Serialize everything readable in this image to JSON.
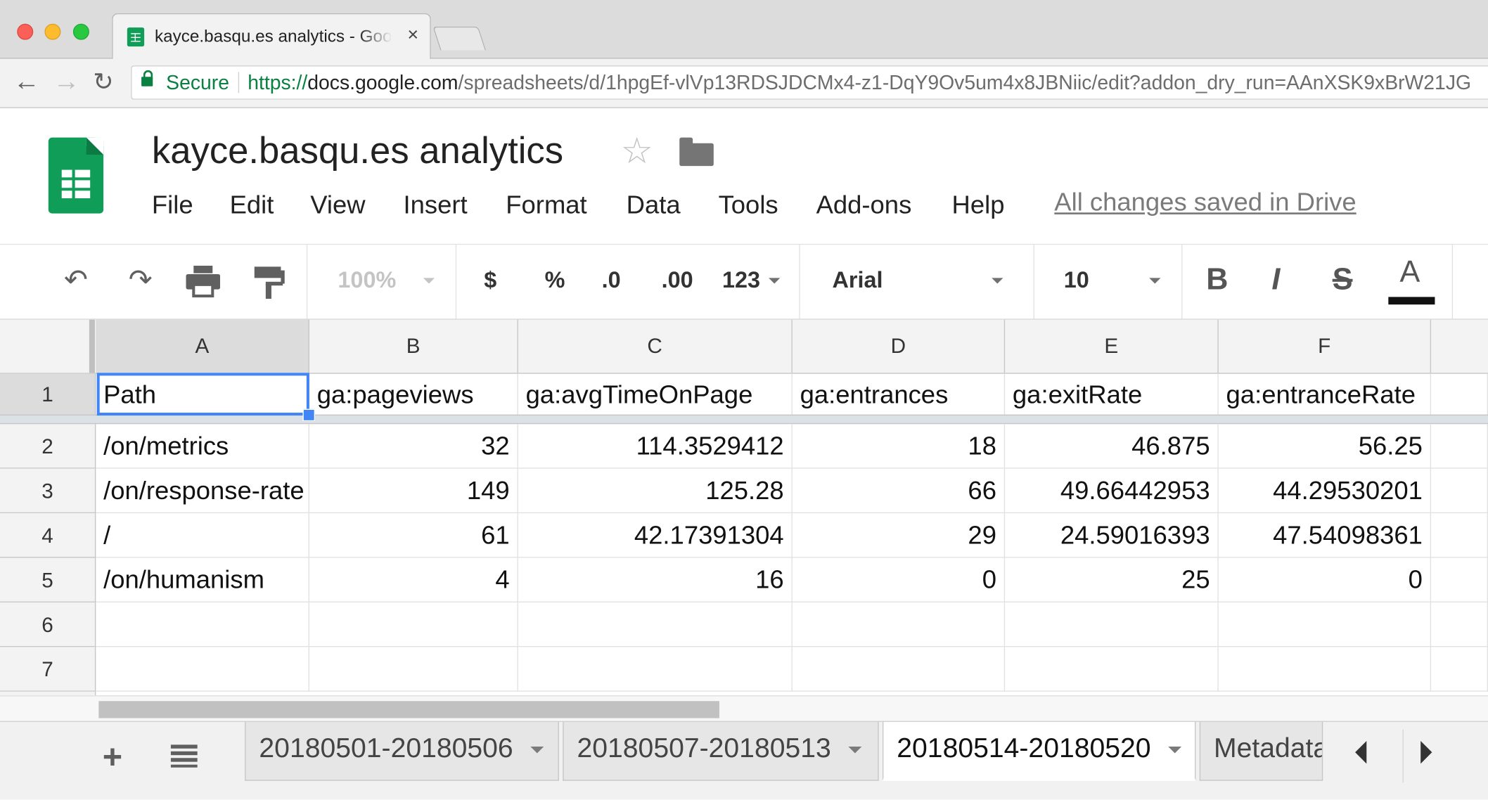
{
  "browser": {
    "tab_title": "kayce.basqu.es analytics - Google Sheets",
    "tab_close": "×",
    "secure_label": "Secure",
    "url_scheme": "https://",
    "url_host": "docs.google.com",
    "url_path": "/spreadsheets/d/1hpgEf-vlVp13RDSJDCMx4-z1-DqY9Ov5um4x8JBNiic/edit?addon_dry_run=AAnXSK9xBrW21JG"
  },
  "doc": {
    "title": "kayce.basqu.es analytics",
    "save_status": "All changes saved in Drive"
  },
  "menu": [
    "File",
    "Edit",
    "View",
    "Insert",
    "Format",
    "Data",
    "Tools",
    "Add-ons",
    "Help"
  ],
  "toolbar": {
    "zoom": "100%",
    "currency": "$",
    "percent": "%",
    "decrease_decimals": ".0",
    "increase_decimals": ".00",
    "more_formats": "123",
    "font": "Arial",
    "font_size": "10",
    "bold": "B",
    "italic": "I",
    "strikethrough": "S",
    "text_color": "A",
    "text_color_value": "#111111"
  },
  "grid": {
    "columns": [
      "A",
      "B",
      "C",
      "D",
      "E",
      "F"
    ],
    "row_numbers": [
      "1",
      "2",
      "3",
      "4",
      "5",
      "6",
      "7"
    ],
    "header_row": [
      "Path",
      "ga:pageviews",
      "ga:avgTimeOnPage",
      "ga:entrances",
      "ga:exitRate",
      "ga:entranceRate"
    ],
    "rows": [
      [
        "/on/metrics",
        "32",
        "114.3529412",
        "18",
        "46.875",
        "56.25"
      ],
      [
        "/on/response-rate",
        "149",
        "125.28",
        "66",
        "49.66442953",
        "44.29530201"
      ],
      [
        "/",
        "61",
        "42.17391304",
        "29",
        "24.59016393",
        "47.54098361"
      ],
      [
        "/on/humanism",
        "4",
        "16",
        "0",
        "25",
        "0"
      ]
    ],
    "selected_cell": "A1",
    "accent_color": "#4285f4"
  },
  "sheets": {
    "tabs": [
      "20180501-20180506",
      "20180507-20180513",
      "20180514-20180520",
      "Metadata"
    ],
    "active": "20180514-20180520",
    "add_label": "+"
  }
}
